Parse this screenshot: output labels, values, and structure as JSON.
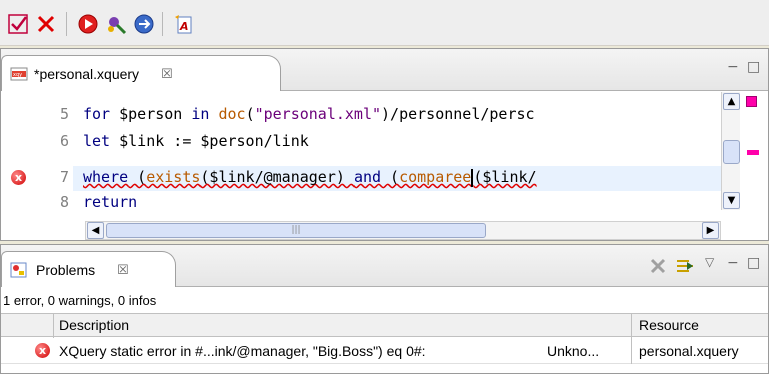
{
  "toolbar": {
    "buttons": [
      {
        "name": "check-icon",
        "glyph": "✔",
        "color": "#c0003c"
      },
      {
        "name": "cancel-icon",
        "glyph": "✕",
        "color": "#e00000"
      },
      {
        "name": "run-icon",
        "glyph": "▶",
        "color": "#e00000"
      },
      {
        "name": "debug-icon",
        "glyph": "✱",
        "color": "#7a3fb0"
      },
      {
        "name": "step-icon",
        "glyph": "➜",
        "color": "#2a5ab8"
      },
      {
        "name": "new-file-icon",
        "glyph": "✦",
        "color": "#d08000"
      }
    ]
  },
  "editor": {
    "tab_label": "*personal.xquery",
    "tab_close": "☒",
    "minimize": "−",
    "maximize": "□",
    "lines": [
      {
        "no": "5"
      },
      {
        "no": "6"
      },
      {
        "no": "7"
      },
      {
        "no": "8"
      }
    ],
    "line5": {
      "kw1": "for",
      "t1": " $person ",
      "kw2": "in",
      "t2": " ",
      "fn": "doc",
      "t3": "(",
      "str": "\"personal.xml\"",
      "t4": ")/personnel/persc"
    },
    "line6": {
      "kw1": "let",
      "t1": " $link := $person/link"
    },
    "line7": {
      "kw1": "where",
      "t1": " (",
      "fn1": "exists",
      "t2": "($link/@manager) ",
      "kw2": "and",
      "t3": " (",
      "fn2": "comparee",
      "t4": "($link/"
    },
    "line8": {
      "kw1": "return"
    },
    "scroll_up": "▲",
    "scroll_down": "▼",
    "scroll_left": "◀",
    "scroll_right": "▶",
    "hthumb_grip": "|||"
  },
  "problems": {
    "tab_label": "Problems",
    "tab_close": "☒",
    "summary": "1 error, 0 warnings, 0 infos",
    "columns": [
      "Description",
      "Resource"
    ],
    "rows": [
      {
        "description": "XQuery static error in #...ink/@manager, \"Big.Boss\") eq 0#:",
        "extra": "Unkno...",
        "resource": "personal.xquery"
      }
    ],
    "view_menu": "▽",
    "minimize": "−",
    "maximize": "□"
  },
  "colors": {
    "keyword": "#000080",
    "function": "#b85a00",
    "string": "#6b007a",
    "error": "#d00000",
    "highlight_line": "#e8f2fe",
    "ruler_mark": "#ff00aa"
  }
}
